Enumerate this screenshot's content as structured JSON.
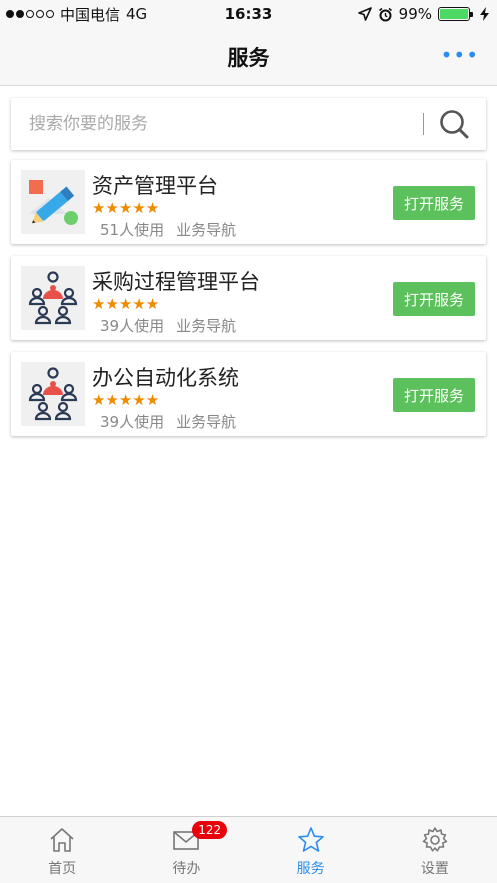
{
  "status_bar": {
    "carrier": "中国电信",
    "network": "4G",
    "time": "16:33",
    "battery": "99%"
  },
  "nav": {
    "title": "服务",
    "more_label": "•••"
  },
  "search": {
    "placeholder": "搜索你要的服务"
  },
  "services": [
    {
      "title": "资产管理平台",
      "stars": "★★★★★",
      "users": "51人使用",
      "category": "业务导航",
      "button": "打开服务",
      "icon": "pencil-icon"
    },
    {
      "title": "采购过程管理平台",
      "stars": "★★★★★",
      "users": "39人使用",
      "category": "业务导航",
      "button": "打开服务",
      "icon": "people-group-icon"
    },
    {
      "title": "办公自动化系统",
      "stars": "★★★★★",
      "users": "39人使用",
      "category": "业务导航",
      "button": "打开服务",
      "icon": "people-group-icon"
    }
  ],
  "tabs": [
    {
      "label": "首页",
      "icon": "home-icon"
    },
    {
      "label": "待办",
      "icon": "mail-icon",
      "badge": "122"
    },
    {
      "label": "服务",
      "icon": "star-icon",
      "active": true
    },
    {
      "label": "设置",
      "icon": "gear-icon"
    }
  ],
  "colors": {
    "accent": "#2d8cf0",
    "button_green": "#5cc15c",
    "star_orange": "#f08a00",
    "badge_red": "#e8000b"
  }
}
